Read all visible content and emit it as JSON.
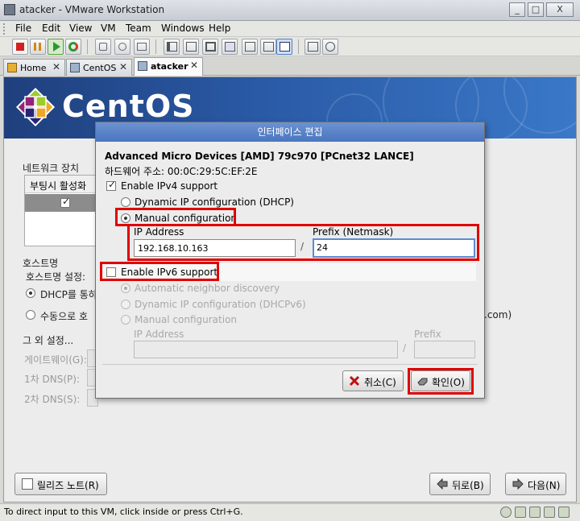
{
  "window": {
    "title": "atacker - VMware Workstation",
    "buttons": [
      "_",
      "□",
      "X"
    ]
  },
  "menu": [
    "File",
    "Edit",
    "View",
    "VM",
    "Team",
    "Windows",
    "Help"
  ],
  "tabs": [
    {
      "label": "Home",
      "icon": "home-icon",
      "active": false
    },
    {
      "label": "CentOS",
      "icon": "vm-icon",
      "active": false
    },
    {
      "label": "atacker",
      "icon": "vm-icon",
      "active": true
    }
  ],
  "tab_close": "✕",
  "vm": {
    "logo_text": "CentOS",
    "network_device_label": "네트워크 장치",
    "boot_activate_header": "부팅시 활성화",
    "hostname_label": "호스트명",
    "hostname_setting_label": "호스트명 설정:",
    "dhcp_option": "DHCP를 통하",
    "manual_option": "수동으로 호",
    "com_suffix": ".com)",
    "other_settings": "그 외 설정...",
    "gateway_label": "게이트웨이(G):",
    "dns1_label": "1차 DNS(P):",
    "dns2_label": "2차 DNS(S):",
    "release_notes_button": "릴리즈 노트(R)",
    "back_button": "뒤로(B)",
    "next_button": "다음(N)"
  },
  "dialog": {
    "title": "인터페이스 편집",
    "device_name": "Advanced Micro Devices [AMD] 79c970 [PCnet32 LANCE]",
    "hw_address": "하드웨어 주소: 00:0C:29:5C:EF:2E",
    "enable_ipv4": "Enable IPv4 support",
    "ipv4_enabled": true,
    "dhcp_label": "Dynamic IP configuration (DHCP)",
    "manual_label": "Manual configuration",
    "ip_address_label": "IP Address",
    "prefix_label": "Prefix (Netmask)",
    "ip_address_value": "192.168.10.163",
    "prefix_value": "24",
    "slash": "/",
    "enable_ipv6": "Enable IPv6 support",
    "ipv6_enabled": false,
    "ipv6_auto": "Automatic neighbor discovery",
    "ipv6_dhcp": "Dynamic IP configuration (DHCPv6)",
    "ipv6_manual": "Manual configuration",
    "ipv6_ip_label": "IP Address",
    "ipv6_prefix_label": "Prefix",
    "cancel_button": "취소(C)",
    "ok_button": "확인(O)"
  },
  "status": {
    "message": "To direct input to this VM, click inside or press Ctrl+G."
  },
  "colors": {
    "highlight_red": "#e00000",
    "dialog_title": "#4a76bf",
    "banner": "#2a5aa6"
  }
}
